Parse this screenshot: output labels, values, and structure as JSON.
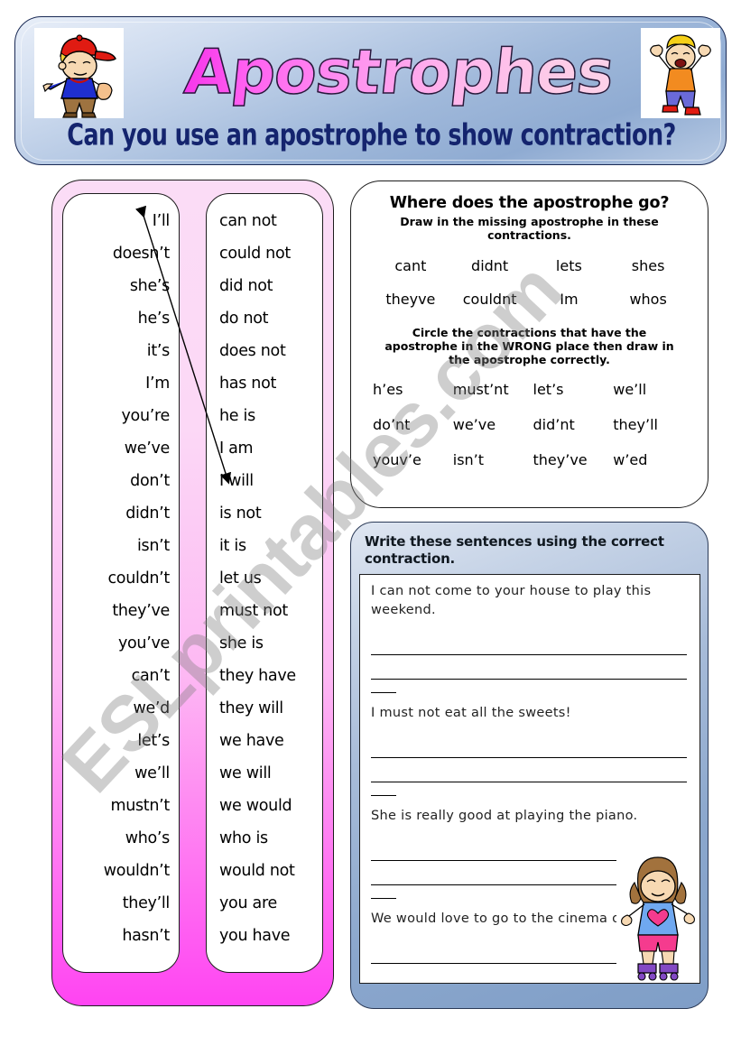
{
  "header": {
    "title": "Apostrophes",
    "subtitle": "Can you use an apostrophe to show contraction?",
    "left_clipart": "boy-with-red-cap-clipart",
    "right_clipart": "cheering-boy-clipart"
  },
  "watermark": {
    "text": "ESLprintables.com"
  },
  "match_panel": {
    "contractions": [
      "I’ll",
      "doesn’t",
      "she’s",
      "he’s",
      "it’s",
      "I’m",
      "you’re",
      "we’ve",
      "don’t",
      "didn’t",
      "isn’t",
      "couldn’t",
      "they’ve",
      "you’ve",
      "can’t",
      "we’d",
      "let’s",
      "we’ll",
      "mustn’t",
      "who’s",
      "wouldn’t",
      "they’ll",
      "hasn’t"
    ],
    "expansions": [
      "can not",
      "could not",
      "did not",
      "do not",
      "does not",
      "has not",
      "he is",
      "I am",
      "I will",
      "is not",
      "it is",
      "let us",
      "must not",
      "she is",
      "they have",
      "they will",
      "we have",
      "we will",
      "we would",
      "who is",
      "would not",
      "you are",
      "you have"
    ],
    "example_link": {
      "from": "I’ll",
      "to": "I will"
    }
  },
  "apostrophe_panel": {
    "heading": "Where does the apostrophe go?",
    "instruction_1": "Draw in the missing apostrophe in these contractions.",
    "missing_words": [
      "cant",
      "didnt",
      "lets",
      "shes",
      "theyve",
      "couldnt",
      "Im",
      "whos"
    ],
    "instruction_2": "Circle the contractions that have the apostrophe in the WRONG place then draw in the apostrophe correctly.",
    "wrong_words": [
      "h’es",
      "must’nt",
      "let’s",
      "we’ll",
      "do’nt",
      "we’ve",
      "did’nt",
      "they’ll",
      "youv’e",
      "isn’t",
      "they’ve",
      "w’ed"
    ]
  },
  "sentences_panel": {
    "title": "Write these sentences using the correct contraction.",
    "sentences": [
      "I can not come to your house to play this weekend.",
      "I must not eat all the sweets!",
      "She is really good at playing the piano.",
      "We would love to go to the cinema on ·"
    ],
    "clipart": "girl-on-rollerskates-clipart"
  }
}
